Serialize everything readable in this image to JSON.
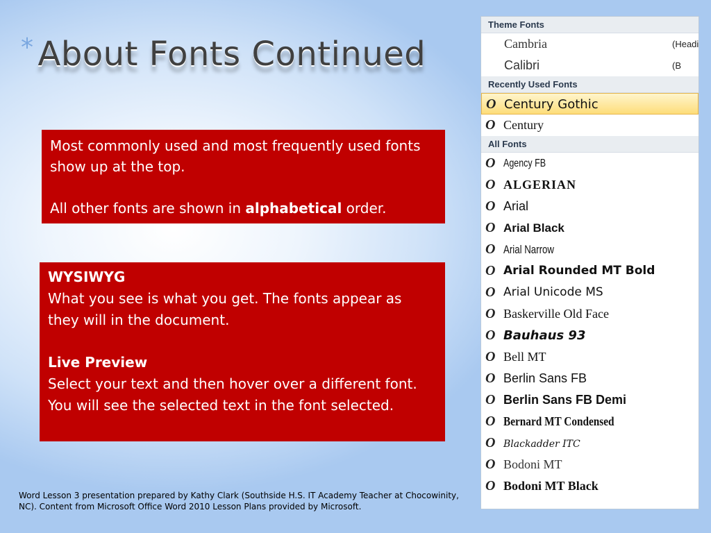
{
  "slide": {
    "title_bullet": "*",
    "title": "About Fonts Continued",
    "box1": {
      "line1": "Most commonly used and most frequently used fonts show up at the top.",
      "line2_pre": "All other fonts are shown in ",
      "line2_bold": "alphabetical",
      "line2_post": " order."
    },
    "box2": {
      "heading1": "WYSIWYG",
      "text1": "What you see is what you get. The fonts appear as they will in the document.",
      "heading2": "Live Preview",
      "text2": "Select your text and then hover over a different font. You will see the selected text in the font selected."
    },
    "footer": "Word Lesson 3 presentation prepared by Kathy Clark (Southside H.S. IT Academy Teacher at Chocowinity, NC). Content from Microsoft Office Word 2010 Lesson Plans provided by Microsoft."
  },
  "font_panel": {
    "icon_glyph": "O",
    "theme_header": "Theme Fonts",
    "theme_fonts": [
      {
        "name": "Cambria",
        "hint": "(Headi"
      },
      {
        "name": "Calibri",
        "hint": "(B"
      }
    ],
    "recent_header": "Recently Used Fonts",
    "recent_fonts": [
      "Century Gothic",
      "Century"
    ],
    "all_header": "All Fonts",
    "all_fonts": [
      "Agency FB",
      "ALGERIAN",
      "Arial",
      "Arial Black",
      "Arial Narrow",
      "Arial Rounded MT Bold",
      "Arial Unicode MS",
      "Baskerville Old Face",
      "Bauhaus 93",
      "Bell MT",
      "Berlin Sans FB",
      "Berlin Sans FB Demi",
      "Bernard MT Condensed",
      "Blackadder ITC",
      "Bodoni MT",
      "Bodoni MT Black"
    ],
    "selection_color": "#fddd7a",
    "accent_red": "#c00000"
  }
}
